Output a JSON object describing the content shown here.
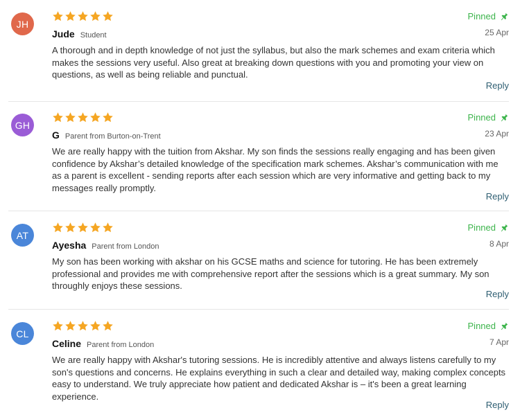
{
  "reviews": [
    {
      "initials": "JH",
      "avatar_color": "#e0684b",
      "name": "Jude",
      "role": "Student",
      "rating": 5,
      "pinned_label": "Pinned",
      "date": "25 Apr",
      "text": "A thorough and in depth knowledge of not just the syllabus, but also the mark schemes and exam criteria which makes the sessions very useful. Also great at breaking down questions with you and promoting your view on questions, as well as being reliable and punctual.",
      "reply_label": "Reply"
    },
    {
      "initials": "GH",
      "avatar_color": "#9a5cd6",
      "name": "G",
      "role": "Parent from Burton-on-Trent",
      "rating": 5,
      "pinned_label": "Pinned",
      "date": "23 Apr",
      "text": "We are really happy with the tuition from Akshar. My son finds the sessions really engaging and has been given confidence by Akshar’s detailed knowledge of the specification mark schemes. Akshar’s communication with me as a parent is excellent - sending reports after each session which are very informative and getting back to my messages really promptly.",
      "reply_label": "Reply"
    },
    {
      "initials": "AT",
      "avatar_color": "#4a86d9",
      "name": "Ayesha",
      "role": "Parent from London",
      "rating": 5,
      "pinned_label": "Pinned",
      "date": "8 Apr",
      "text": "My son has been working with akshar on his GCSE maths and science for tutoring. He has been extremely professional and provides me with comprehensive report after the sessions which is a great summary. My son throughly enjoys these sessions.",
      "reply_label": "Reply"
    },
    {
      "initials": "CL",
      "avatar_color": "#4a86d9",
      "name": "Celine",
      "role": "Parent from London",
      "rating": 5,
      "pinned_label": "Pinned",
      "date": "7 Apr",
      "text": "We are really happy with Akshar's tutoring sessions. He is incredibly attentive and always listens carefully to my son's questions and concerns. He explains everything in such a clear and detailed way, making complex concepts easy to understand. We truly appreciate how patient and dedicated Akshar is – it's been a great learning experience.",
      "reply_label": "Reply"
    }
  ],
  "colors": {
    "star": "#f5a623",
    "pinned": "#3cb44b",
    "reply": "#2e5e72",
    "divider": "#e6e6e6"
  }
}
